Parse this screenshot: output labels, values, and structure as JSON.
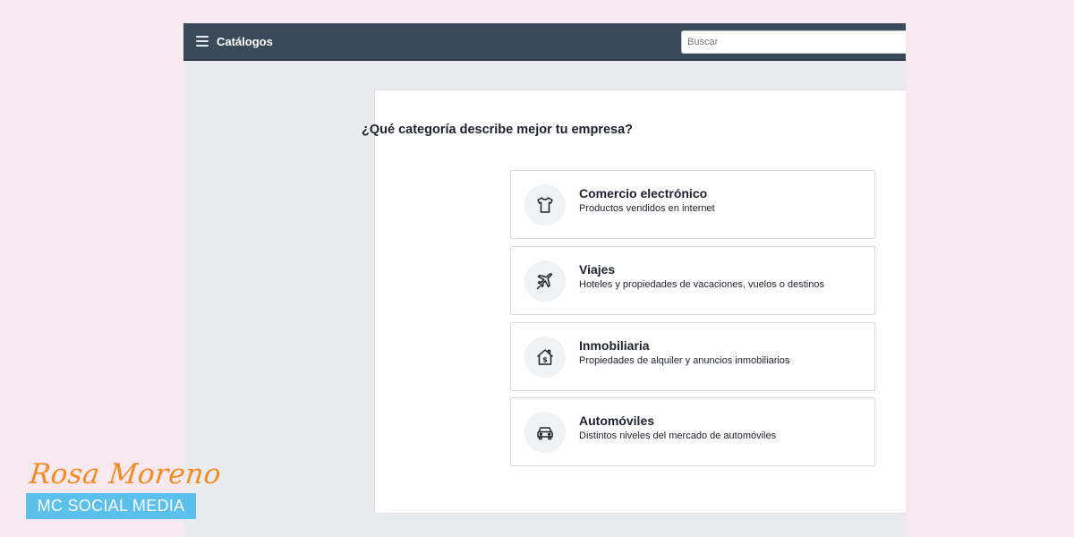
{
  "header": {
    "title": "Catálogos",
    "search_placeholder": "Buscar",
    "menu_icon": "hamburger-menu-icon",
    "background_color": "#3b4a5a"
  },
  "main": {
    "question": "¿Qué categoría describe mejor tu empresa?",
    "categories": [
      {
        "title": "Comercio electrónico",
        "description": "Productos vendidos en internet",
        "icon": "tshirt-icon"
      },
      {
        "title": "Viajes",
        "description": "Hoteles y propiedades de vacaciones, vuelos o destinos",
        "icon": "airplane-icon"
      },
      {
        "title": "Inmobiliaria",
        "description": "Propiedades de alquiler y anuncios inmobiliarios",
        "icon": "house-dollar-icon"
      },
      {
        "title": "Automóviles",
        "description": "Distintos niveles del mercado de automóviles",
        "icon": "car-icon"
      }
    ]
  },
  "watermark": {
    "name": "Rosa Moreno",
    "tagline": "MC SOCIAL MEDIA",
    "name_color": "#f58a1f",
    "tagline_background": "#5bc0eb"
  },
  "colors": {
    "page_background": "#f8e8f0",
    "app_background": "#e9ebee",
    "card_border": "#d7d9dd"
  }
}
